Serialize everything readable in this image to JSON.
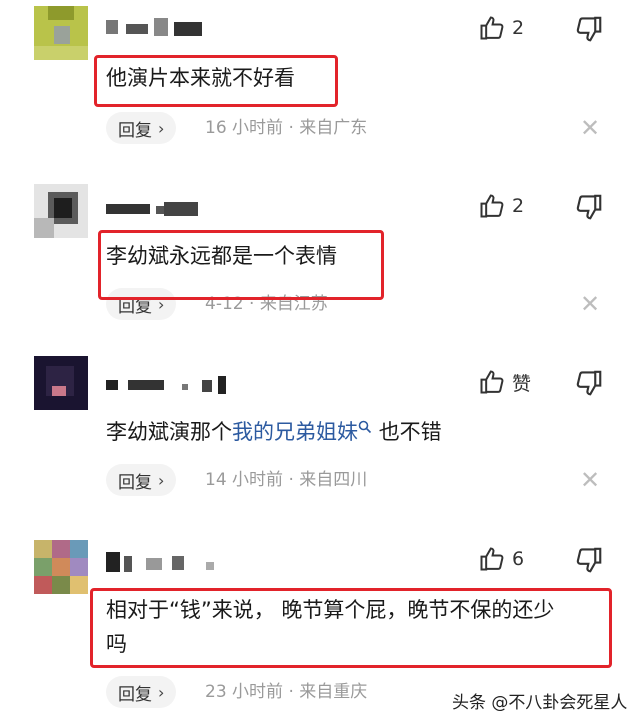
{
  "comments": [
    {
      "text": "他演片本来就不好看",
      "likes": "2",
      "reply": "回复",
      "time": "16 小时前",
      "location": "来自广东",
      "highlighted": true
    },
    {
      "text": "李幼斌永远都是一个表情",
      "likes": "2",
      "reply": "回复",
      "time": "4-12",
      "location": "来自江苏",
      "highlighted": true
    },
    {
      "text_before": "李幼斌演那个",
      "link": "我的兄弟姐妹",
      "text_after": "也不错",
      "likes": "赞",
      "reply": "回复",
      "time": "14 小时前",
      "location": "来自四川",
      "highlighted": false
    },
    {
      "text_line1": "相对于“钱”来说， 晚节算个屁，晚节不保的还少",
      "text_line2": "吗",
      "likes": "6",
      "reply": "回复",
      "time": "23 小时前",
      "location": "来自重庆",
      "highlighted": true
    }
  ],
  "meta_separator": "·",
  "watermark": "头条 @不八卦会死星人",
  "icons": {
    "like": "thumbs-up-icon",
    "dislike": "thumbs-down-icon",
    "close": "close-icon",
    "search": "search-icon",
    "chevron": "chevron-right-icon"
  },
  "colors": {
    "highlight_border": "#e2232a",
    "link": "#2c5aa0",
    "meta": "#9a9a9a"
  }
}
